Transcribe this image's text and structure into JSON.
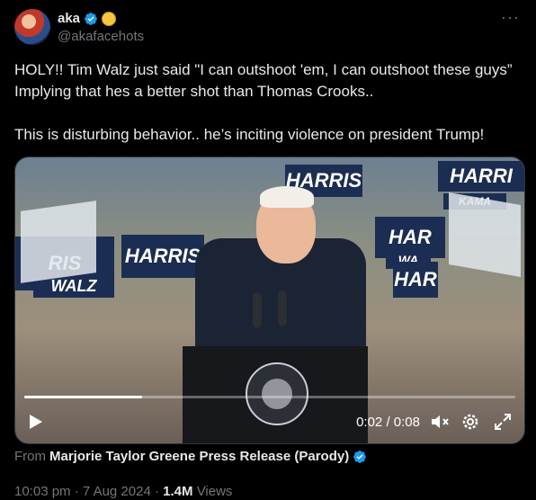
{
  "author": {
    "display_name": "aka",
    "handle": "@akafacehots",
    "verified": true
  },
  "post": {
    "paragraphs": [
      "HOLY!! Tim Walz just said \"I can outshoot 'em, I can outshoot these guys” Implying that hes a better shot than Thomas Crooks..",
      "This is disturbing behavior.. he’s inciting violence on president Trump!"
    ]
  },
  "video": {
    "current_time": "0:02",
    "separator": "/",
    "duration": "0:08",
    "progress_fraction": 0.24,
    "signs": [
      "HARRIS",
      "RIS",
      "HARRIS",
      "WALZ",
      "HAR",
      "WA",
      "HARRI",
      "KAMA",
      "HAR"
    ]
  },
  "source": {
    "prefix": "From",
    "name": "Marjorie Taylor Greene Press Release (Parody)"
  },
  "meta": {
    "time": "10:03 pm",
    "dot1": "·",
    "date": "7 Aug 2024",
    "dot2": "·",
    "views_count": "1.4M",
    "views_label": "Views"
  },
  "colors": {
    "background": "#000000",
    "text": "#e7e9ea",
    "muted": "#71767b",
    "verified_blue": "#1d9bf0"
  }
}
